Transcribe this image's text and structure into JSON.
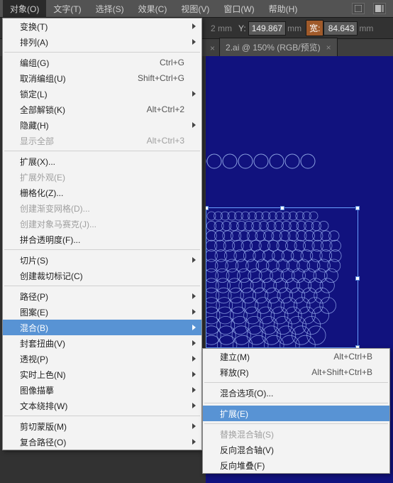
{
  "menubar": {
    "items": [
      "对象(O)",
      "文字(T)",
      "选择(S)",
      "效果(C)",
      "视图(V)",
      "窗口(W)",
      "帮助(H)"
    ]
  },
  "optbar": {
    "y_label": "Y:",
    "y_value": "149.867",
    "unit": "mm",
    "w_label": "宽:",
    "w_value": "84.643"
  },
  "tab": {
    "label": "2.ai @ 150% (RGB/预览)",
    "close": "×",
    "pin": "×"
  },
  "menu1": [
    {
      "t": "变换(T)",
      "sub": true
    },
    {
      "t": "排列(A)",
      "sub": true
    },
    {
      "sep": true
    },
    {
      "t": "编组(G)",
      "k": "Ctrl+G"
    },
    {
      "t": "取消编组(U)",
      "k": "Shift+Ctrl+G"
    },
    {
      "t": "锁定(L)",
      "sub": true
    },
    {
      "t": "全部解锁(K)",
      "k": "Alt+Ctrl+2"
    },
    {
      "t": "隐藏(H)",
      "sub": true
    },
    {
      "t": "显示全部",
      "k": "Alt+Ctrl+3",
      "dis": true
    },
    {
      "sep": true
    },
    {
      "t": "扩展(X)..."
    },
    {
      "t": "扩展外观(E)",
      "dis": true
    },
    {
      "t": "栅格化(Z)..."
    },
    {
      "t": "创建渐变网格(D)...",
      "dis": true
    },
    {
      "t": "创建对象马赛克(J)...",
      "dis": true
    },
    {
      "t": "拼合透明度(F)..."
    },
    {
      "sep": true
    },
    {
      "t": "切片(S)",
      "sub": true
    },
    {
      "t": "创建裁切标记(C)"
    },
    {
      "sep": true
    },
    {
      "t": "路径(P)",
      "sub": true
    },
    {
      "t": "图案(E)",
      "sub": true
    },
    {
      "t": "混合(B)",
      "sub": true,
      "hi": true
    },
    {
      "t": "封套扭曲(V)",
      "sub": true
    },
    {
      "t": "透视(P)",
      "sub": true
    },
    {
      "t": "实时上色(N)",
      "sub": true
    },
    {
      "t": "图像描摹",
      "sub": true
    },
    {
      "t": "文本绕排(W)",
      "sub": true
    },
    {
      "sep": true
    },
    {
      "t": "剪切蒙版(M)",
      "sub": true
    },
    {
      "t": "复合路径(O)",
      "sub": true
    }
  ],
  "menu2": [
    {
      "t": "建立(M)",
      "k": "Alt+Ctrl+B"
    },
    {
      "t": "释放(R)",
      "k": "Alt+Shift+Ctrl+B"
    },
    {
      "sep": true
    },
    {
      "t": "混合选项(O)..."
    },
    {
      "sep": true
    },
    {
      "t": "扩展(E)",
      "hi": true
    },
    {
      "sep": true
    },
    {
      "t": "替换混合轴(S)",
      "dis": true
    },
    {
      "t": "反向混合轴(V)"
    },
    {
      "t": "反向堆叠(F)"
    }
  ]
}
